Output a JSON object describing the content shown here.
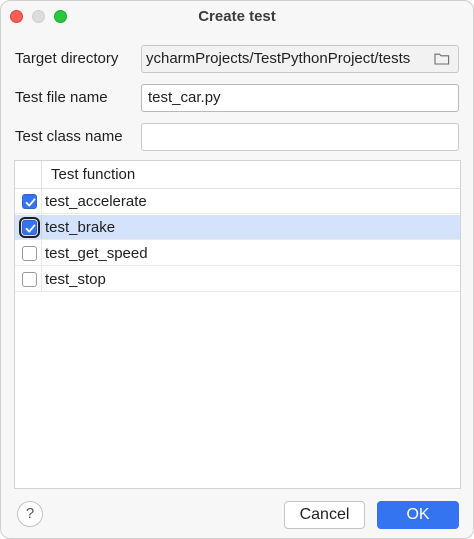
{
  "window": {
    "title": "Create test"
  },
  "form": {
    "target_directory_label": "Target directory",
    "target_directory_value": "ycharmProjects/TestPythonProject/tests",
    "test_file_name_label": "Test file name",
    "test_file_name_value": "test_car.py",
    "test_class_name_label": "Test class name",
    "test_class_name_value": ""
  },
  "table": {
    "column_header": "Test function",
    "rows": [
      {
        "name": "test_accelerate",
        "checked": true,
        "selected": false
      },
      {
        "name": "test_brake",
        "checked": true,
        "selected": true
      },
      {
        "name": "test_get_speed",
        "checked": false,
        "selected": false
      },
      {
        "name": "test_stop",
        "checked": false,
        "selected": false
      }
    ]
  },
  "footer": {
    "help_label": "?",
    "cancel_label": "Cancel",
    "ok_label": "OK"
  },
  "colors": {
    "accent": "#3574f0",
    "selection": "#d4e2fc"
  },
  "icons": {
    "close": "close-icon",
    "minimize": "minimize-icon",
    "maximize": "maximize-icon",
    "folder": "folder-icon",
    "checkmark": "checkmark-icon"
  }
}
